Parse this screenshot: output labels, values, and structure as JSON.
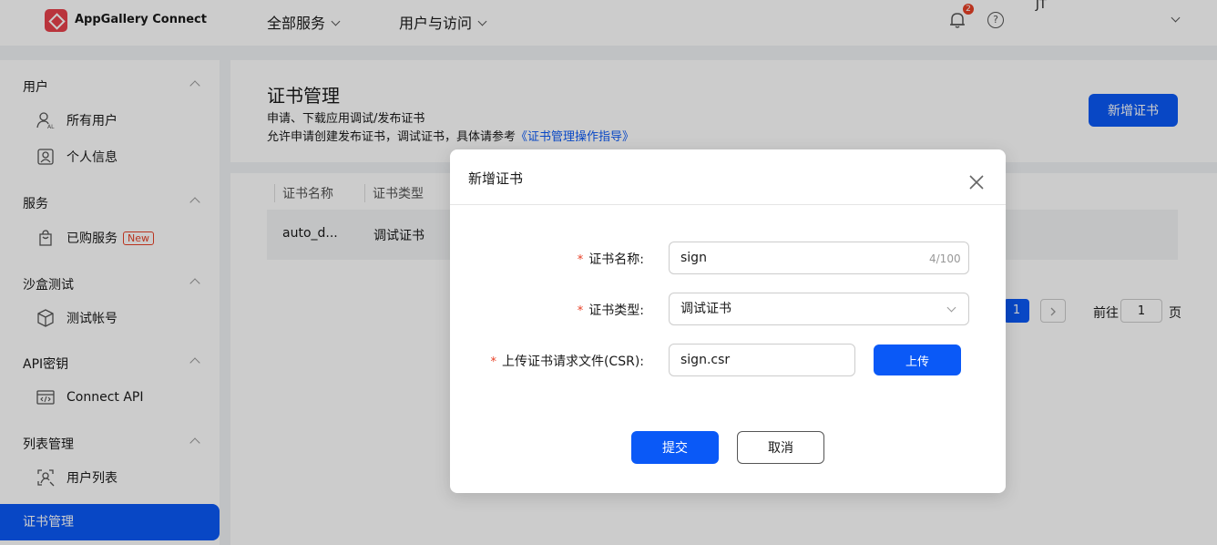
{
  "app": {
    "brand": "AppGallery Connect",
    "logo_icon": "appgallery-logo-icon",
    "brand_color": "#e8424b",
    "accent": "#0a59f7"
  },
  "topnav": {
    "items": [
      {
        "label": "全部服务"
      },
      {
        "label": "用户与访问"
      }
    ],
    "notification_count": "2",
    "help_glyph": "?",
    "user": "JT"
  },
  "sidebar": {
    "sections": [
      {
        "title": "用户",
        "items": [
          {
            "label": "所有用户",
            "icon": "all-users-icon"
          },
          {
            "label": "个人信息",
            "icon": "profile-icon"
          }
        ]
      },
      {
        "title": "服务",
        "items": [
          {
            "label": "已购服务",
            "icon": "shopping-bag-icon",
            "tag": "New"
          }
        ]
      },
      {
        "title": "沙盒测试",
        "items": [
          {
            "label": "测试帐号",
            "icon": "cube-icon"
          }
        ]
      },
      {
        "title": "API密钥",
        "items": [
          {
            "label": "Connect API",
            "icon": "code-window-icon"
          }
        ]
      },
      {
        "title": "列表管理",
        "items": [
          {
            "label": "用户列表",
            "icon": "user-list-icon"
          }
        ]
      }
    ],
    "active": "证书管理"
  },
  "page": {
    "title": "证书管理",
    "desc1": "申请、下载应用调试/发布证书",
    "desc2_prefix": "允许申请创建发布证书，调试证书，具体请参考",
    "desc2_link": "《证书管理操作指导》",
    "add_button": "新增证书"
  },
  "table": {
    "headers": [
      "证书名称",
      "证书类型"
    ],
    "rows": [
      [
        "auto_d...",
        "调试证书"
      ]
    ],
    "pagination": {
      "current": "1",
      "goto_label": "前往",
      "goto_value": "1",
      "page_suffix": "页"
    }
  },
  "modal": {
    "title": "新增证书",
    "required_mark": "*",
    "fields": {
      "name": {
        "label": "证书名称:",
        "value": "sign",
        "counter": "4/100"
      },
      "type": {
        "label": "证书类型:",
        "value": "调试证书"
      },
      "csr": {
        "label": "上传证书请求文件(CSR):",
        "value": "sign.csr"
      }
    },
    "upload_button": "上传",
    "submit_button": "提交",
    "cancel_button": "取消"
  }
}
